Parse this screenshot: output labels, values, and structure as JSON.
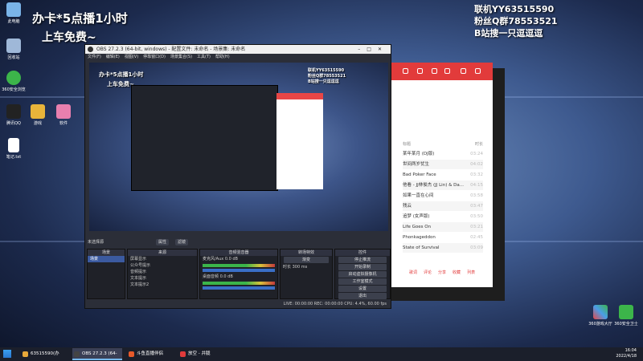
{
  "desktop": {
    "icons": [
      {
        "label": "此电脑"
      },
      {
        "label": "回收站"
      },
      {
        "label": "360安全浏览"
      },
      {
        "label": "腾讯QQ"
      },
      {
        "label": "游戏"
      },
      {
        "label": "软件"
      },
      {
        "label": "笔记.txt"
      }
    ],
    "right_icons": [
      {
        "label": "360游戏大厅"
      },
      {
        "label": "360安全卫士"
      }
    ],
    "promo_left_line1": "办卡*5点播1小时",
    "promo_left_line2": "上车免费~",
    "promo_right_line1": "联机YY63515590",
    "promo_right_line2": "粉丝Q群78553521",
    "promo_right_line3": "B站搜一只逗逗逗"
  },
  "obs": {
    "title": "OBS 27.2.3 (64-bit, windows) - 配置文件: 未命名 - 场景集: 未命名",
    "menu": [
      "文件(F)",
      "编辑(E)",
      "视图(V)",
      "停靠窗口(D)",
      "场景集合(S)",
      "工具(T)",
      "帮助(H)"
    ],
    "source_label": "未选择源",
    "props_label": "属性",
    "filters_label": "滤镜",
    "docks": {
      "scenes_title": "场景",
      "scene_item": "场景",
      "sources_title": "来源",
      "sources": [
        "屏幕显示",
        "公众号提示",
        "音频提示",
        "文本提示",
        "文本提示2"
      ],
      "mixer_title": "音频混音器",
      "mixer_channels": [
        {
          "name": "麦克风/Aux",
          "level": "0.0 dB"
        },
        {
          "name": "桌面音频",
          "level": "0.0 dB"
        }
      ],
      "transition_title": "转场特效",
      "transition_value": "渐变",
      "duration_label": "时长",
      "duration_value": "300 ms",
      "controls_title": "控件",
      "controls": [
        "停止推流",
        "开始录制",
        "启动虚拟摄像机",
        "工作室模式",
        "设置",
        "退出"
      ]
    },
    "status": "LIVE: 00:00:00   REC: 00:00:00   CPU: 4.4%, 60.00 fps"
  },
  "music": {
    "header_col_title": "标题",
    "header_col_time": "时长",
    "songs": [
      {
        "title": "某年某月 (DJ版)",
        "time": "03:24"
      },
      {
        "title": "世间两岁忧生",
        "time": "04:02"
      },
      {
        "title": "Bad Poker Face",
        "time": "03:32"
      },
      {
        "title": "他看 - JJ林俊杰 (JJ Lin) & Da...",
        "time": "04:15"
      },
      {
        "title": "如果一直在心间",
        "time": "03:58"
      },
      {
        "title": "残云",
        "time": "03:47"
      },
      {
        "title": "追梦 (女声版)",
        "time": "03:50"
      },
      {
        "title": "Life Goes On",
        "time": "03:21"
      },
      {
        "title": "Phonkageddon",
        "time": "02:45"
      },
      {
        "title": "State of Survival",
        "time": "03:09"
      }
    ],
    "footer": [
      "歌词",
      "评论",
      "分享",
      "收藏",
      "列表"
    ]
  },
  "taskbar": {
    "items": [
      {
        "label": "63515590(办_B)...",
        "color": "#e8a93a"
      },
      {
        "label": "OBS 27.2.3 (64-bit...",
        "color": "#444444"
      },
      {
        "label": "斗鱼直播伴侣",
        "color": "#e85a2a"
      },
      {
        "label": "放空 - 井胧",
        "color": "#e23b3b"
      }
    ],
    "time": "16:04",
    "date": "2022/4/18"
  }
}
